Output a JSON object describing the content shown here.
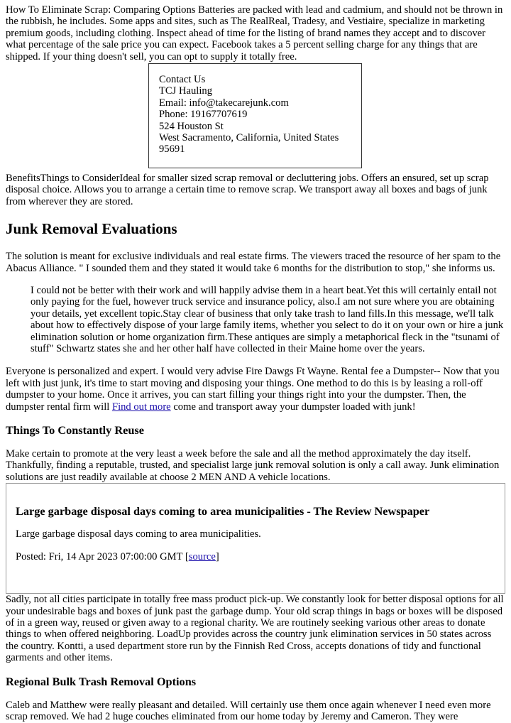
{
  "intro": "How To Eliminate Scrap: Comparing Options Batteries are packed with lead and cadmium, and should not be thrown in the rubbish, he includes. Some apps and sites, such as The RealReal, Tradesy, and Vestiaire, specialize in marketing premium goods, including clothing. Inspect ahead of time for the listing of brand names they accept and to discover what percentage of the sale price you can expect. Facebook takes a 5 percent selling charge for any things that are shipped. If your thing doesn't sell, you can opt to supply it totally free.",
  "contact": {
    "heading": "Contact Us",
    "company": "TCJ Hauling",
    "email": "Email: info@takecarejunk.com",
    "phone": "Phone: 19167707619",
    "street": "524 Houston St",
    "city": "West Sacramento, California, United States",
    "zip": "95691"
  },
  "benefits": "BenefitsThings to ConsiderIdeal for smaller sized scrap removal or decluttering jobs. Offers an ensured, set up scrap disposal choice. Allows you to arrange a certain time to remove scrap. We transport away all boxes and bags of junk from wherever they are stored.",
  "section1": {
    "heading": "Junk Removal Evaluations",
    "para": "The solution is meant for exclusive individuals and real estate firms. The viewers traced the resource of her spam to the Abacus Alliance. \" I sounded them and they stated it would take 6 months for the distribution to stop,\" she informs us.",
    "quote": "I could not be better with their work and will happily advise them in a heart beat.Yet this will certainly entail not only paying for the fuel, however truck service and insurance policy, also.I am not sure where you are obtaining your details, yet excellent topic.Stay clear of business that only take trash to land fills.In this message, we'll talk about how to effectively dispose of your large family items, whether you select to do it on your own or hire a junk elimination solution or home organization firm.These antiques are simply a metaphorical fleck in the \"tsunami of stuff\" Schwartz states she and her other half have collected in their Maine home over the years.",
    "para2_before": "Everyone is personalized and expert. I would very advise Fire Dawgs Ft Wayne. Rental fee a Dumpster-- Now that you left with just junk, it's time to start moving and disposing your things. One method to do this is by leasing a roll-off dumpster to your home. Once it arrives, you can start filling your things right into your the dumpster. Then, the dumpster rental firm will ",
    "link": "Find out more",
    "para2_after": " come and transport away your dumpster loaded with junk!"
  },
  "section2": {
    "heading": "Things To Constantly Reuse",
    "para": "Make certain to promote at the very least a week before the sale and all the method approximately the day itself. Thankfully, finding a reputable, trusted, and specialist large junk removal solution is only a call away. Junk elimination solutions are just readily available at choose 2 MEN AND A vehicle locations."
  },
  "news": {
    "title": "Large garbage disposal days coming to area municipalities - The Review Newspaper",
    "summary": "Large garbage disposal days coming to area municipalities.",
    "posted": "Posted: Fri, 14 Apr 2023 07:00:00 GMT [",
    "source_link": "source",
    "posted_end": "]"
  },
  "section3_para": "Sadly, not all cities participate in totally free mass product pick-up. We constantly look for better disposal options for all your undesirable bags and boxes of junk past the garbage dump. Your old scrap things in bags or boxes will be disposed of in a green way, reused or given away to a regional charity. We are routinely seeking various other areas to donate things to when offered neighboring. LoadUp provides across the country junk elimination services in 50 states across the country. Kontti, a used department store run by the Finnish Red Cross, accepts donations of tidy and functional garments and other items.",
  "section4": {
    "heading": "Regional Bulk Trash Removal Options",
    "para": "Caleb and Matthew were really pleasant and detailed. Will certainly use them once again whenever I need even more scrap removed. We had 2 huge couches eliminated from our home today by Jeremy and Cameron. They were"
  }
}
